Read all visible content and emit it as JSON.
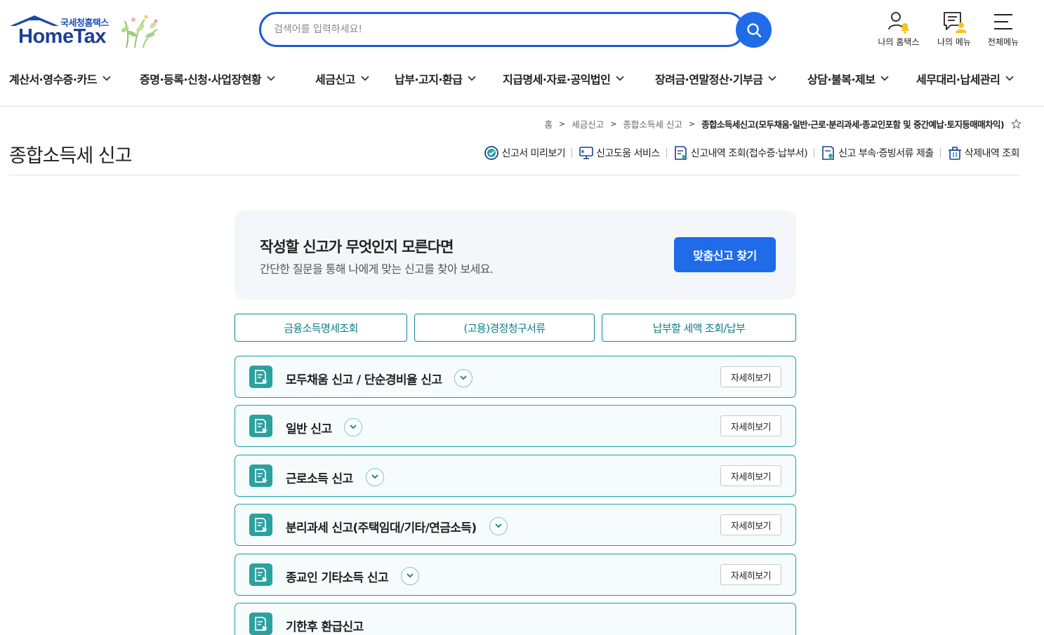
{
  "header": {
    "logo_sub": "국세청홈택스",
    "logo_main": "HomeTax",
    "search_placeholder": "검색어를 입력하세요!",
    "util": [
      {
        "label": "나의 홈택스",
        "icon": "my-hometax-icon"
      },
      {
        "label": "나의 메뉴",
        "icon": "my-menu-icon"
      },
      {
        "label": "전체메뉴",
        "icon": "hamburger-icon"
      }
    ]
  },
  "gnb": [
    "계산서·영수증·카드",
    "증명·등록·신청·사업장현황",
    "세금신고",
    "납부·고지·환급",
    "지급명세·자료·공익법인",
    "장려금·연말정산·기부금",
    "상담·불복·제보",
    "세무대리·납세관리"
  ],
  "breadcrumb": {
    "items": [
      "홈",
      "세금신고",
      "종합소득세 신고"
    ],
    "current": "종합소득세신고(모두채움·일반·근로·분리과세·종교인포함 및 중간예납·토지등매매차익)"
  },
  "page_title": "종합소득세 신고",
  "actions": [
    {
      "label": "신고서 미리보기",
      "icon": "preview-check-icon"
    },
    {
      "label": "신고도움 서비스",
      "icon": "monitor-help-icon"
    },
    {
      "label": "신고내역 조회(접수증·납부서)",
      "icon": "document-search-icon"
    },
    {
      "label": "신고 부속·증빙서류 제출",
      "icon": "document-upload-icon"
    },
    {
      "label": "삭제내역 조회",
      "icon": "trash-icon"
    }
  ],
  "guide": {
    "title": "작성할 신고가 무엇인지 모른다면",
    "desc": "간단한 질문을 통해 나에게 맞는 신고를 찾아 보세요.",
    "button": "맞춤신고 찾기"
  },
  "quick_buttons": [
    "금융소득명세조회",
    "(고용)경정청구서류",
    "납부할 세액 조회/납부"
  ],
  "accordion": [
    {
      "title": "모두채움 신고 / 단순경비율 신고",
      "more": "자세히보기"
    },
    {
      "title": "일반 신고",
      "more": "자세히보기"
    },
    {
      "title": "근로소득 신고",
      "more": "자세히보기"
    },
    {
      "title": "분리과세 신고(주택임대/기타/연금소득)",
      "more": "자세히보기"
    },
    {
      "title": "종교인 기타소득 신고",
      "more": "자세히보기"
    },
    {
      "title": "기한후 환급신고",
      "more": ""
    }
  ],
  "colors": {
    "brand_blue": "#1f6be8",
    "teal": "#16a0a4",
    "logo_navy": "#1c3f94"
  }
}
